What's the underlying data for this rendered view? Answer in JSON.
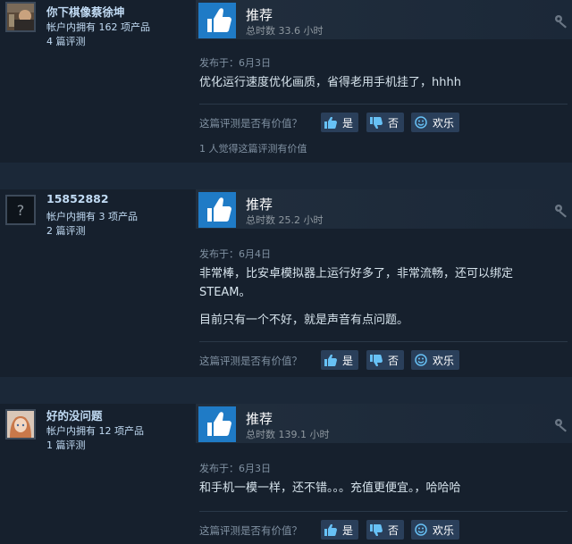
{
  "reviews": [
    {
      "author": {
        "name": "你下棋像蔡徐坤",
        "products": "帐户内拥有 162 项产品",
        "reviews": "4 篇评测",
        "avatar": "photo"
      },
      "vote": {
        "title": "推荐",
        "hours": "总时数 33.6 小时",
        "icon": "thumbs-up-icon"
      },
      "posted": "发布于：6月3日",
      "paragraphs": [
        "优化运行速度优化画质，省得老用手机挂了，hhhh"
      ],
      "helpful_question": "这篇评测是否有价值？",
      "buttons": {
        "yes": "是",
        "no": "否",
        "funny": "欢乐"
      },
      "found_helpful": "1 人觉得这篇评测有价值"
    },
    {
      "author": {
        "name": "15852882",
        "products": "帐户内拥有 3 项产品",
        "reviews": "2 篇评测",
        "avatar": "question-mark"
      },
      "vote": {
        "title": "推荐",
        "hours": "总时数 25.2 小时",
        "icon": "thumbs-up-icon"
      },
      "posted": "发布于：6月4日",
      "paragraphs": [
        "非常棒，比安卓模拟器上运行好多了，非常流畅，还可以绑定STEAM。",
        "目前只有一个不好，就是声音有点问题。"
      ],
      "helpful_question": "这篇评测是否有价值？",
      "buttons": {
        "yes": "是",
        "no": "否",
        "funny": "欢乐"
      },
      "found_helpful": ""
    },
    {
      "author": {
        "name": "好的没问题",
        "products": "帐户内拥有 12 项产品",
        "reviews": "1 篇评测",
        "avatar": "anime-character"
      },
      "vote": {
        "title": "推荐",
        "hours": "总时数 139.1 小时",
        "icon": "thumbs-up-icon"
      },
      "posted": "发布于：6月3日",
      "paragraphs": [
        "和手机一模一样，还不错。。。充值更便宜。，哈哈哈"
      ],
      "helpful_question": "这篇评测是否有价值？",
      "buttons": {
        "yes": "是",
        "no": "否",
        "funny": "欢乐"
      },
      "found_helpful": ""
    }
  ]
}
